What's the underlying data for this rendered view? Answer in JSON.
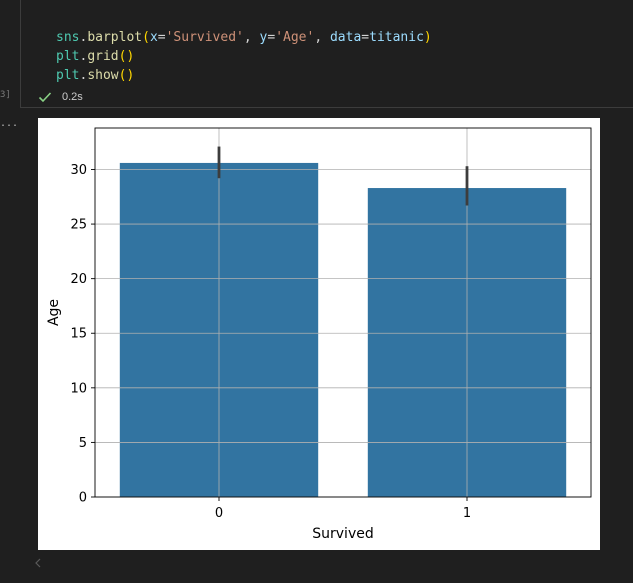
{
  "cell": {
    "execution_count": "3]",
    "code_lines": [
      [
        {
          "t": "sns",
          "c": "tk-var"
        },
        {
          "t": ".",
          "c": ""
        },
        {
          "t": "barplot",
          "c": "tk-fn"
        },
        {
          "t": "(",
          "c": "tk-p"
        },
        {
          "t": "x",
          "c": "tk-param"
        },
        {
          "t": "=",
          "c": ""
        },
        {
          "t": "'Survived'",
          "c": "tk-str"
        },
        {
          "t": ", ",
          "c": ""
        },
        {
          "t": "y",
          "c": "tk-param"
        },
        {
          "t": "=",
          "c": ""
        },
        {
          "t": "'Age'",
          "c": "tk-str"
        },
        {
          "t": ", ",
          "c": ""
        },
        {
          "t": "data",
          "c": "tk-param"
        },
        {
          "t": "=",
          "c": ""
        },
        {
          "t": "titanic",
          "c": "tk-param"
        },
        {
          "t": ")",
          "c": "tk-p"
        }
      ],
      [
        {
          "t": "plt",
          "c": "tk-var"
        },
        {
          "t": ".",
          "c": ""
        },
        {
          "t": "grid",
          "c": "tk-fn"
        },
        {
          "t": "()",
          "c": "tk-p"
        }
      ],
      [
        {
          "t": "plt",
          "c": "tk-var"
        },
        {
          "t": ".",
          "c": ""
        },
        {
          "t": "show",
          "c": "tk-fn"
        },
        {
          "t": "()",
          "c": "tk-p"
        }
      ]
    ],
    "status_icon": "check-icon",
    "exec_time": "0.2s",
    "output_ellipsis": "..."
  },
  "colors": {
    "bar": "#3274a1",
    "errbar": "#3d3d3d",
    "grid": "#b0b0b0",
    "check": "#89d185"
  },
  "chart_data": {
    "type": "bar",
    "categories": [
      "0",
      "1"
    ],
    "values": [
      30.6,
      28.3
    ],
    "ci": [
      [
        29.2,
        32.1
      ],
      [
        26.7,
        30.3
      ]
    ],
    "xlabel": "Survived",
    "ylabel": "Age",
    "ylim": [
      0,
      33.8
    ],
    "yticks": [
      0,
      5,
      10,
      15,
      20,
      25,
      30
    ],
    "grid": true
  }
}
